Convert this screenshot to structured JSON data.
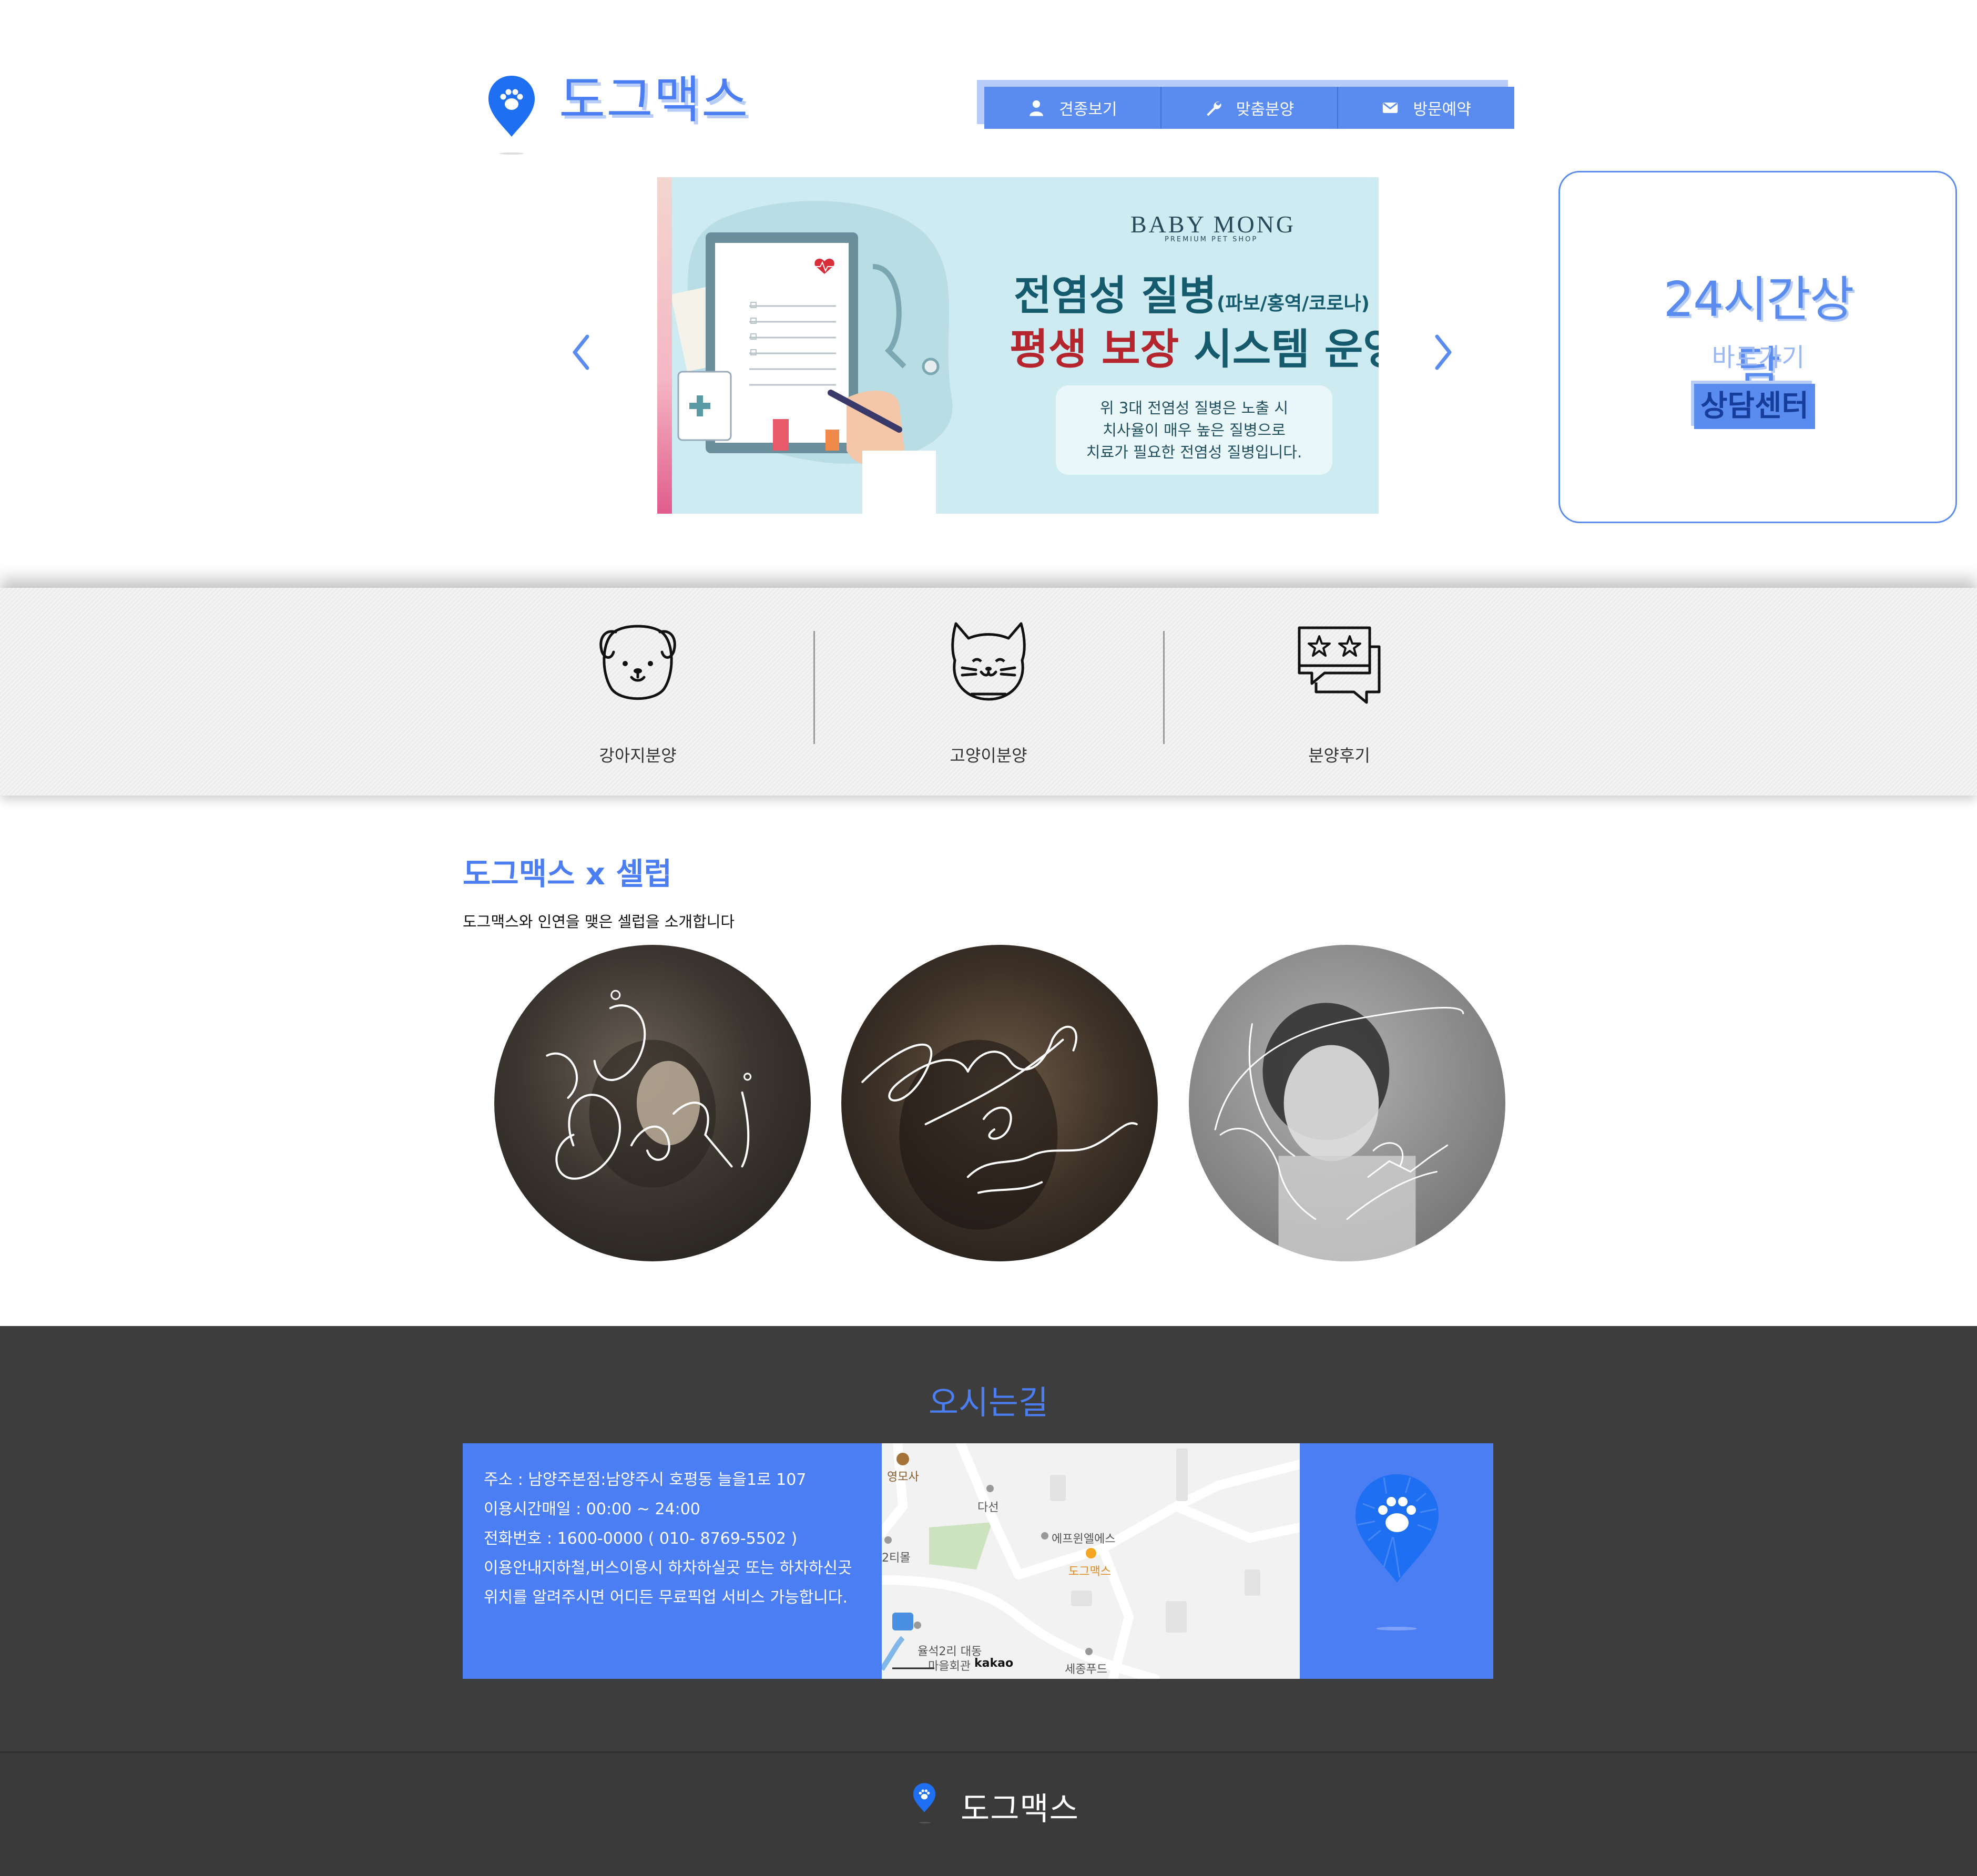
{
  "header": {
    "logo_text": "도그맥스",
    "nav": [
      {
        "label": "견종보기",
        "icon": "user-icon"
      },
      {
        "label": "맞춤분양",
        "icon": "wrench-icon"
      },
      {
        "label": "방문예약",
        "icon": "envelope-icon"
      }
    ]
  },
  "slider": {
    "brand": "BABY MONG",
    "brand_sub": "PREMIUM PET SHOP",
    "line1": "전염성 질병",
    "line1_small": "(파보/홍역/코로나)",
    "line2_red": "평생 보장",
    "line2_rest": "시스템 운영",
    "box_lines": [
      "위 3대 전염성 질병은 노출 시",
      "치사율이 매우 높은 질병으로",
      "치료가 필요한 전염성 질병입니다."
    ]
  },
  "consult": {
    "title": "24시간상담",
    "subtitle": "바로가기",
    "button": "상담센터"
  },
  "categories": [
    {
      "label": "강아지분양",
      "icon": "dog-icon"
    },
    {
      "label": "고양이분양",
      "icon": "cat-icon"
    },
    {
      "label": "분양후기",
      "icon": "review-icon"
    }
  ],
  "celeb": {
    "title": "도그맥스 x 셀럽",
    "desc": "도그맥스와 인연을 맺은 셀럽을 소개합니다"
  },
  "directions": {
    "title": "오시는길",
    "info": [
      "주소 : 남양주본점:남양주시 호평동 늘을1로 107",
      "이용시간매일 : 00:00 ~ 24:00",
      "전화번호 : 1600-0000 ( 010- 8769-5502 )",
      "이용안내지하철,버스이용시 하차하실곳 또는 하차하신곳",
      "위치를 알려주시면 어디든 무료픽업 서비스 가능합니다."
    ],
    "map_labels": {
      "temple": "영모사",
      "dason": "다선",
      "eff": "에프윈엘에스",
      "dogmax": "도그맥스",
      "tee": "2티몰",
      "bus": "율석2리 대동",
      "hall": "마을회관",
      "kakao": "kakao",
      "sejong": "세종푸드"
    }
  },
  "footer": {
    "logo_text": "도그맥스"
  },
  "colors": {
    "primary": "#4b7ef2",
    "nav": "#5a8cf0",
    "dark": "#3d3d3d"
  }
}
